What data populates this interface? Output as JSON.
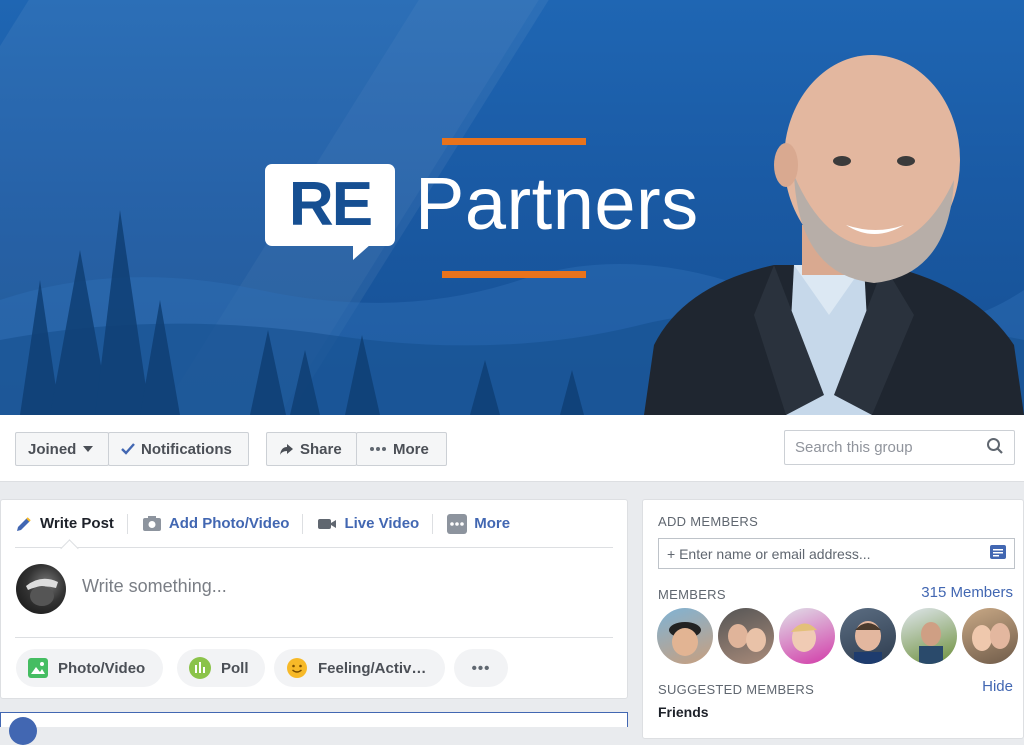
{
  "cover": {
    "logo_re": "RE",
    "logo_partners": "Partners",
    "colors": {
      "background": "#1a5aa4",
      "accent": "#e8731c"
    }
  },
  "actions": {
    "joined": "Joined",
    "notifications": "Notifications",
    "share": "Share",
    "more": "More",
    "search_placeholder": "Search this group"
  },
  "composer": {
    "tabs": [
      {
        "label": "Write Post",
        "icon": "pencil-icon"
      },
      {
        "label": "Add Photo/Video",
        "icon": "camera-icon"
      },
      {
        "label": "Live Video",
        "icon": "video-camera-icon"
      },
      {
        "label": "More",
        "icon": "more-dots-icon"
      }
    ],
    "placeholder": "Write something...",
    "options": [
      {
        "label": "Photo/Video",
        "icon": "photo-icon"
      },
      {
        "label": "Poll",
        "icon": "poll-icon"
      },
      {
        "label": "Feeling/Activ…",
        "icon": "smiley-icon"
      },
      {
        "label": "•••",
        "icon": "ellipsis-icon"
      }
    ]
  },
  "sidebar": {
    "add_members_heading": "ADD MEMBERS",
    "add_members_placeholder": "+ Enter name or email address...",
    "members_heading": "MEMBERS",
    "members_count": "315 Members",
    "suggested_heading": "SUGGESTED MEMBERS",
    "hide": "Hide",
    "friends": "Friends"
  }
}
